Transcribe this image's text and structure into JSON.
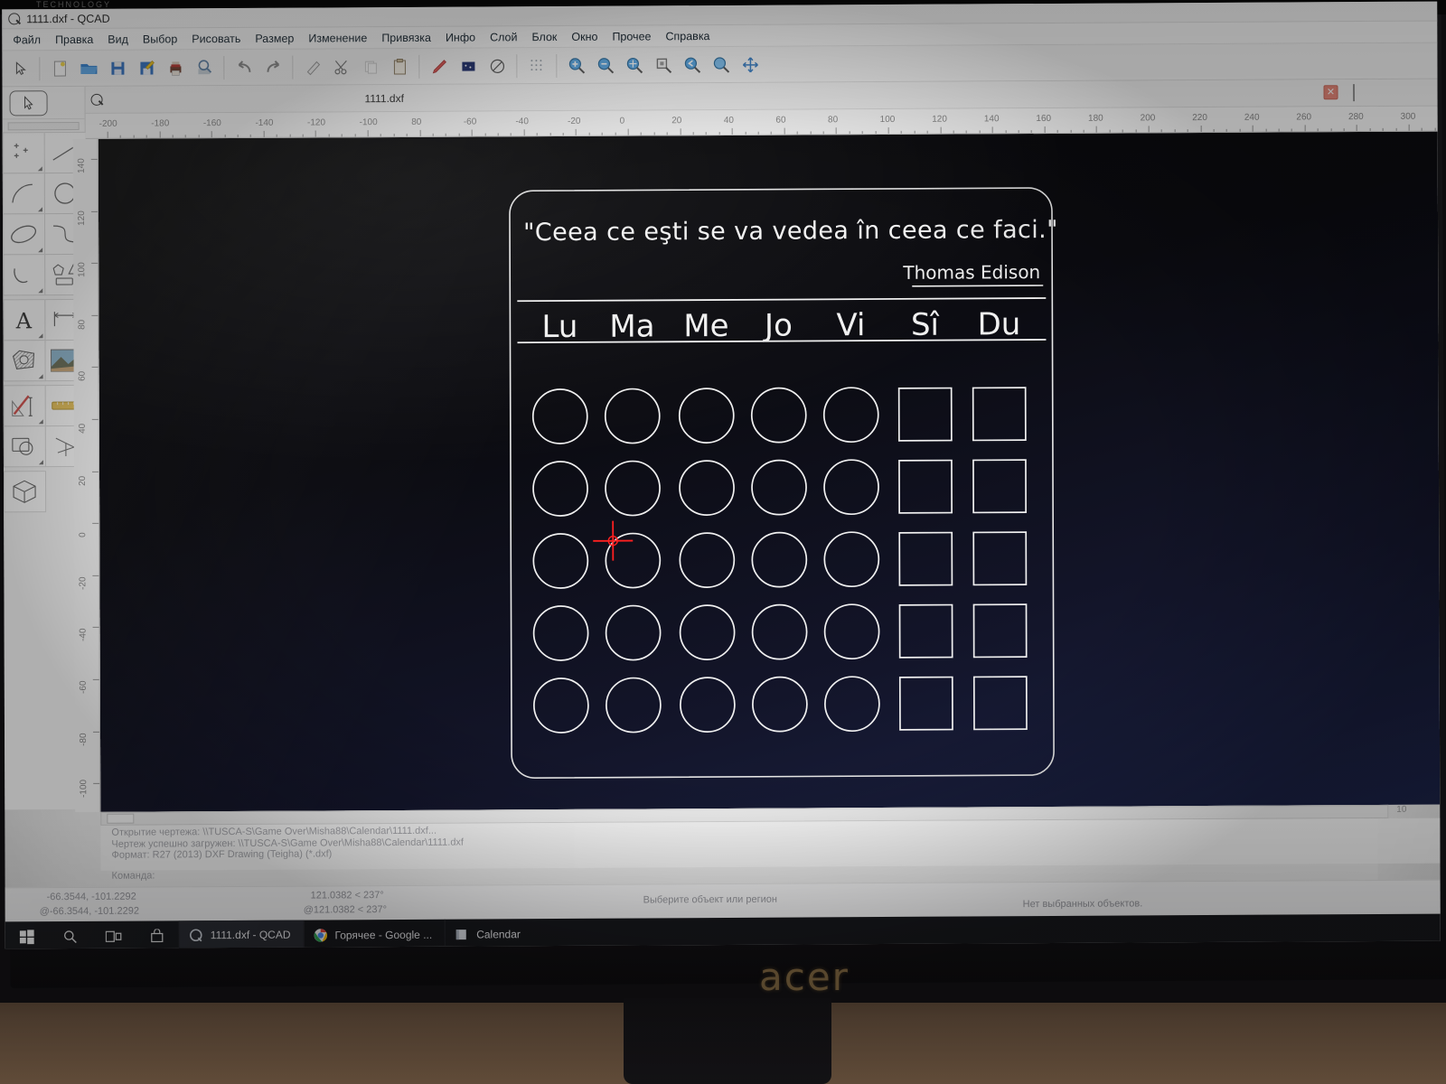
{
  "window": {
    "title": "1111.dxf - QCAD",
    "app_icon": "qcad-icon"
  },
  "menubar": {
    "items": [
      {
        "label": "Файл",
        "name": "menu-file"
      },
      {
        "label": "Правка",
        "name": "menu-edit"
      },
      {
        "label": "Вид",
        "name": "menu-view"
      },
      {
        "label": "Выбор",
        "name": "menu-select"
      },
      {
        "label": "Рисовать",
        "name": "menu-draw"
      },
      {
        "label": "Размер",
        "name": "menu-dimension"
      },
      {
        "label": "Изменение",
        "name": "menu-modify"
      },
      {
        "label": "Привязка",
        "name": "menu-snap"
      },
      {
        "label": "Инфо",
        "name": "menu-info"
      },
      {
        "label": "Слой",
        "name": "menu-layer"
      },
      {
        "label": "Блок",
        "name": "menu-block"
      },
      {
        "label": "Окно",
        "name": "menu-window"
      },
      {
        "label": "Прочее",
        "name": "menu-misc"
      },
      {
        "label": "Справка",
        "name": "menu-help"
      }
    ]
  },
  "toolbar": {
    "groups": [
      [
        "pointer-icon"
      ],
      [
        "new-file-icon",
        "open-folder-icon",
        "save-icon",
        "save-as-icon",
        "print-icon",
        "print-preview-icon"
      ],
      [
        "undo-icon",
        "redo-icon"
      ],
      [
        "eraser-icon",
        "cut-scissors-icon",
        "copy-icon",
        "paste-clipboard-icon"
      ],
      [
        "pen-icon",
        "layer-color-icon",
        "linetype-icon"
      ],
      [
        "grid-icon"
      ],
      [
        "zoom-in-icon",
        "zoom-out-icon",
        "zoom-auto-icon",
        "zoom-window-icon",
        "zoom-previous-icon",
        "zoom-select-icon",
        "pan-icon"
      ]
    ]
  },
  "tool_palette": {
    "selected_tool": "select-pointer-tool",
    "tools": [
      {
        "name": "point-tool",
        "icon": "point-icon"
      },
      {
        "name": "line-tool",
        "icon": "line-icon"
      },
      {
        "name": "arc-tool",
        "icon": "arc-icon"
      },
      {
        "name": "circle-tool",
        "icon": "circle-icon"
      },
      {
        "name": "ellipse-tool",
        "icon": "ellipse-icon"
      },
      {
        "name": "spline-tool",
        "icon": "spline-icon"
      },
      {
        "name": "polyline-tool",
        "icon": "polyline-icon"
      },
      {
        "name": "shape-tool",
        "icon": "polygon-icon"
      },
      {
        "name": "text-tool",
        "icon": "text-a-icon"
      },
      {
        "name": "dimension-tool",
        "icon": "dimension-icon"
      },
      {
        "name": "hatch-tool",
        "icon": "hatch-icon"
      },
      {
        "name": "image-tool",
        "icon": "image-icon"
      },
      {
        "name": "modify-tool",
        "icon": "modify-icon"
      },
      {
        "name": "block-tool",
        "icon": "block-ruler-icon"
      },
      {
        "name": "snap-tool",
        "icon": "snap-icon"
      },
      {
        "name": "measure-tool",
        "icon": "measure-icon"
      },
      {
        "name": "isometric-tool",
        "icon": "cube-icon"
      }
    ]
  },
  "document_tab": {
    "title": "1111.dxf",
    "icon": "qcad-doc-icon",
    "close_label": "✕"
  },
  "rulers": {
    "horizontal_ticks": [
      "-200",
      "-180",
      "-160",
      "-140",
      "-120",
      "-100",
      "80",
      "-60",
      "-40",
      "-20",
      "0",
      "20",
      "40",
      "60",
      "80",
      "100",
      "120",
      "140",
      "160",
      "180",
      "200",
      "220",
      "240",
      "260",
      "280",
      "300"
    ],
    "vertical_ticks": [
      "140",
      "120",
      "100",
      "80",
      "60",
      "40",
      "20",
      "0",
      "-20",
      "-40",
      "-60",
      "-80",
      "-100"
    ]
  },
  "drawing": {
    "quote": "\"Ceea ce eşti se va vedea în ceea ce faci.\"",
    "author": "Thomas Edison",
    "day_headers": [
      "Lu",
      "Ma",
      "Me",
      "Jo",
      "Vi",
      "Sî",
      "Du"
    ],
    "rows": 5,
    "circle_columns": 5,
    "square_columns": 2,
    "stroke_color": "#f0f0f0",
    "cursor_color": "#ff2020",
    "cursor_cell": {
      "row": 3,
      "column": 2
    }
  },
  "command_history": {
    "lines": [
      "Открытие чертежа: \\\\TUSCA-S\\Game Over\\Misha88\\Calendar\\1111.dxf...",
      "Чертеж успешно загружен: \\\\TUSCA-S\\Game Over\\Misha88\\Calendar\\1111.dxf",
      "Формат: R27 (2013) DXF Drawing (Teigha) (*.dxf)"
    ],
    "prompt": "Команда:"
  },
  "statusbar": {
    "absolute_coords": "-66.3544, -101.2292",
    "relative_coords": "@-66.3544, -101.2292",
    "polar_coords": "121.0382 < 237°",
    "relative_polar_coords": "@121.0382 < 237°",
    "hint": "Выберите объект или регион",
    "selection": "Нет выбранных объектов."
  },
  "scrollbar": {
    "right_label": "10"
  },
  "taskbar": {
    "system_icons": [
      "windows-start-icon",
      "search-icon",
      "task-view-icon",
      "store-icon"
    ],
    "buttons": [
      {
        "label": "1111.dxf - QCAD",
        "icon": "qcad-taskbar-icon",
        "active": true
      },
      {
        "label": "Горячее - Google ...",
        "icon": "chrome-icon",
        "active": false
      },
      {
        "label": "Calendar",
        "icon": "explorer-folder-icon",
        "active": false
      }
    ]
  },
  "hardware": {
    "monitor_brand": "acer",
    "bezel_brand": "TECHNOLOGY"
  }
}
